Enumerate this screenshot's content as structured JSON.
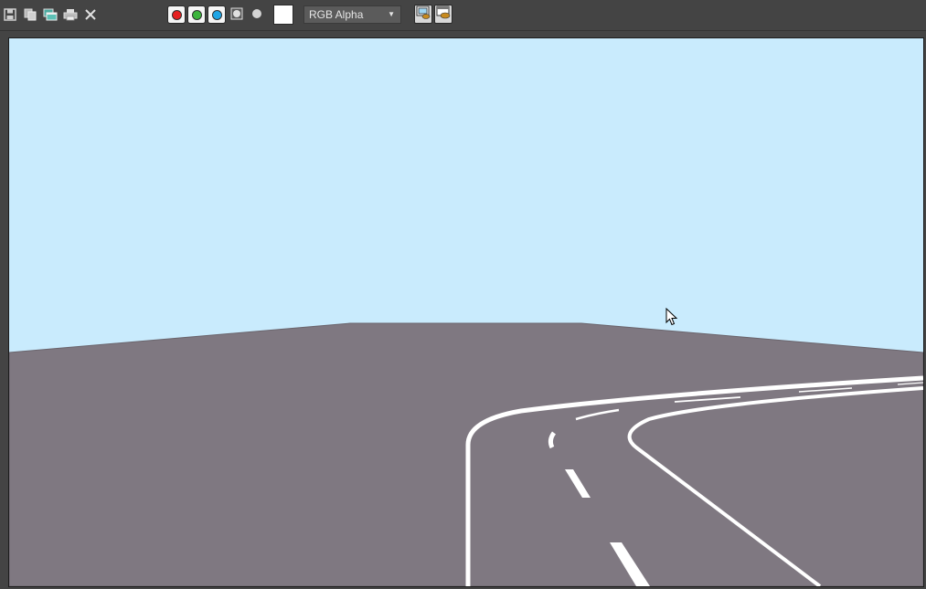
{
  "toolbar": {
    "icons": {
      "save": "save-icon",
      "copy": "copy-icon",
      "clone": "clone-window-icon",
      "print": "print-icon",
      "clear": "close-icon",
      "render_region": "render-region-icon",
      "render_frame": "render-frame-icon"
    },
    "channels": [
      {
        "name": "red-channel",
        "color": "#e52020"
      },
      {
        "name": "green-channel",
        "color": "#3cb43c"
      },
      {
        "name": "blue-channel",
        "color": "#1ea5e6"
      }
    ],
    "channel_display": {
      "selected": "RGB Alpha"
    },
    "swatch_color": "#ffffff"
  },
  "viewport": {
    "sky_color": "#c9ebfd",
    "ground_color": "#7f7881",
    "line_color": "#ffffff"
  }
}
